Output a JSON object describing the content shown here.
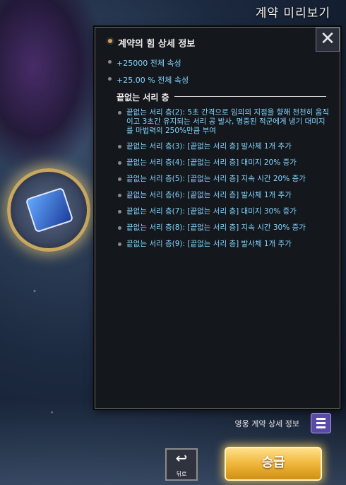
{
  "header": {
    "title": "계약 미리보기"
  },
  "panel": {
    "title": "계약의 힘 상세 정보",
    "stats": [
      "+25000 전체 속성",
      "+25.00 % 전체 속성"
    ],
    "section_title": "끝없는 서리 층",
    "effects": [
      "끝없는 서리 층(2): 5초 간격으로 임의의 지점을 향해 천천히 움직이고 3초간 유지되는 서리 공 발사, 명중된 적군에게 냉기 대미지를 마법력의 250%만큼 부여",
      "끝없는 서리 층(3): [끝없는 서리 층] 발사체 1개 추가",
      "끝없는 서리 층(4): [끝없는 서리 층] 대미지 20% 증가",
      "끝없는 서리 층(5): [끝없는 서리 층] 지속 시간 20% 증가",
      "끝없는 서리 층(6): [끝없는 서리 층] 발사체 1개 추가",
      "끝없는 서리 층(7): [끝없는 서리 층] 대미지 30% 증가",
      "끝없는 서리 층(8): [끝없는 서리 층] 지속 시간 30% 증가",
      "끝없는 서리 층(9): [끝없는 서리 층] 발사체 1개 추가"
    ]
  },
  "bottom": {
    "hero_info_label": "영웅 계약 상세 정보",
    "back_label": "뒤로",
    "upgrade_label": "승급"
  },
  "icons": {
    "close": "close-icon",
    "list": "list-icon",
    "back": "back-arrow-icon"
  },
  "colors": {
    "effect_text": "#84d6ff",
    "upgrade_button": "#f0b63b",
    "panel_bg": "#14171c"
  }
}
